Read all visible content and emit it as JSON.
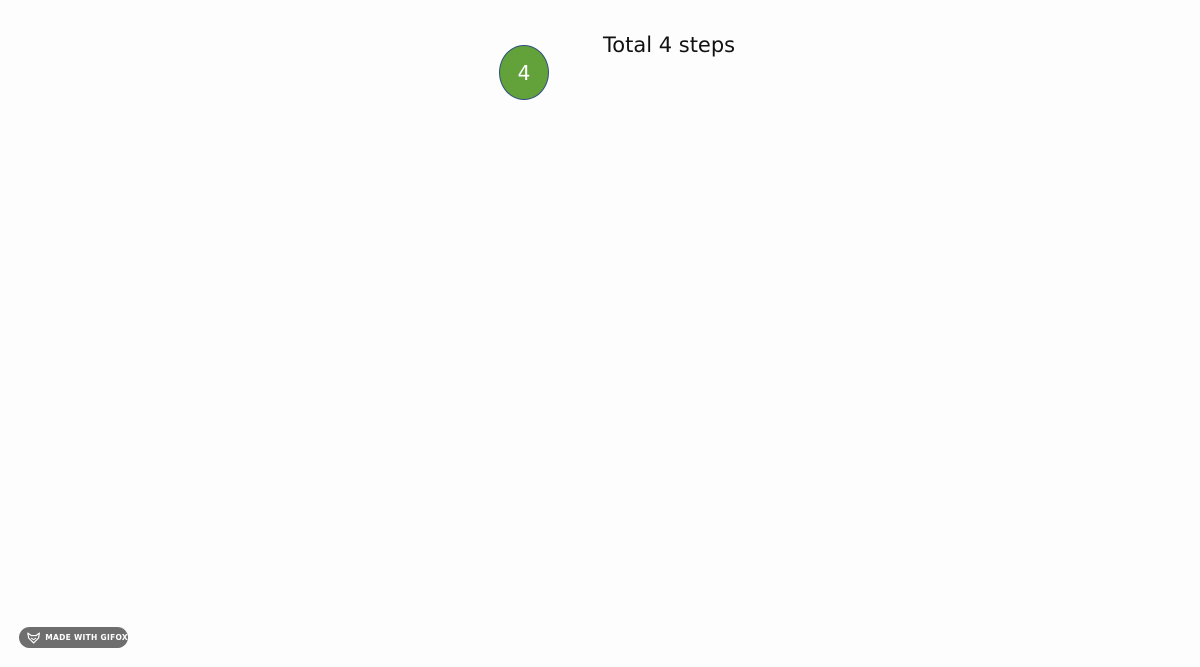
{
  "slide": {
    "step_number": "4",
    "title": "Total 4 steps"
  },
  "watermark": {
    "label": "MADE WITH GIFOX",
    "icon": "fox-icon"
  },
  "colors": {
    "background": "#fdfdfd",
    "circle_fill": "#63a13b",
    "circle_border": "#2f4f7f",
    "badge_background": "#6e6e6e",
    "text": "#111111"
  }
}
